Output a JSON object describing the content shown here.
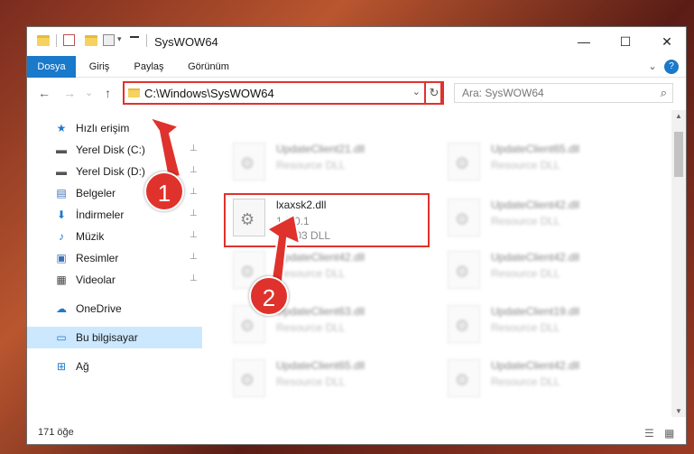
{
  "window": {
    "title": "SysWOW64"
  },
  "titlebar": {
    "minimize": "—",
    "maximize": "☐",
    "close": "✕"
  },
  "ribbon": {
    "tabs": [
      "Dosya",
      "Giriş",
      "Paylaş",
      "Görünüm"
    ],
    "chevron": "⌄",
    "help": "?"
  },
  "address": {
    "path": "C:\\Windows\\SysWOW64",
    "search_placeholder": "Ara: SysWOW64",
    "back": "←",
    "forward": "→",
    "recent": "⌄",
    "up": "↑",
    "dropdown": "⌄",
    "refresh": "↻",
    "search_icon": "⌕"
  },
  "nav": {
    "items": [
      {
        "label": "Hızlı erişim",
        "icon": "star-icon",
        "glyph": "★",
        "color": "#1f7acb"
      },
      {
        "label": "Yerel Disk (C:)",
        "icon": "drive-icon",
        "glyph": "▬",
        "color": "#555",
        "pinned": true
      },
      {
        "label": "Yerel Disk (D:)",
        "icon": "drive-icon",
        "glyph": "▬",
        "color": "#555",
        "pinned": true
      },
      {
        "label": "Belgeler",
        "icon": "documents-icon",
        "glyph": "▤",
        "color": "#3b6fb5",
        "pinned": true
      },
      {
        "label": "İndirmeler",
        "icon": "download-icon",
        "glyph": "⬇",
        "color": "#1f7acb",
        "pinned": true
      },
      {
        "label": "Müzik",
        "icon": "music-icon",
        "glyph": "♪",
        "color": "#1f7acb",
        "pinned": true
      },
      {
        "label": "Resimler",
        "icon": "pictures-icon",
        "glyph": "▣",
        "color": "#3b6fb5",
        "pinned": true
      },
      {
        "label": "Videolar",
        "icon": "videos-icon",
        "glyph": "▦",
        "color": "#444",
        "pinned": true
      },
      {
        "label": "OneDrive",
        "icon": "cloud-icon",
        "glyph": "☁",
        "color": "#1f7acb"
      },
      {
        "label": "Bu bilgisayar",
        "icon": "computer-icon",
        "glyph": "▭",
        "color": "#1f7acb"
      },
      {
        "label": "Ağ",
        "icon": "network-icon",
        "glyph": "⊞",
        "color": "#1f7acb"
      }
    ],
    "pin_glyph": "📌"
  },
  "files": {
    "left": [
      {
        "name": "UpdateClient21.dll",
        "type": "Resource DLL"
      },
      {
        "name": "lxaxsk2.dll",
        "version": "1.0.0.1",
        "type": "skin03 DLL",
        "highlighted": true
      },
      {
        "name": "UpdateClient42.dll",
        "type": "Resource DLL"
      },
      {
        "name": "UpdateClient63.dll",
        "type": "Resource DLL"
      },
      {
        "name": "UpdateClient65.dll",
        "type": "Resource DLL"
      }
    ],
    "right": [
      {
        "name": "UpdateClient65.dll",
        "type": "Resource DLL"
      },
      {
        "name": "UpdateClient42.dll",
        "type": "Resource DLL"
      },
      {
        "name": "UpdateClient42.dll",
        "type": "Resource DLL"
      },
      {
        "name": "UpdateClient19.dll",
        "type": "Resource DLL"
      },
      {
        "name": "UpdateClient42.dll",
        "type": "Resource DLL"
      }
    ]
  },
  "status": {
    "count": "171 öğe",
    "details_view": "☰",
    "tiles_view": "▦"
  },
  "annotations": {
    "step1": "1",
    "step2": "2",
    "color": "#e0322c"
  }
}
